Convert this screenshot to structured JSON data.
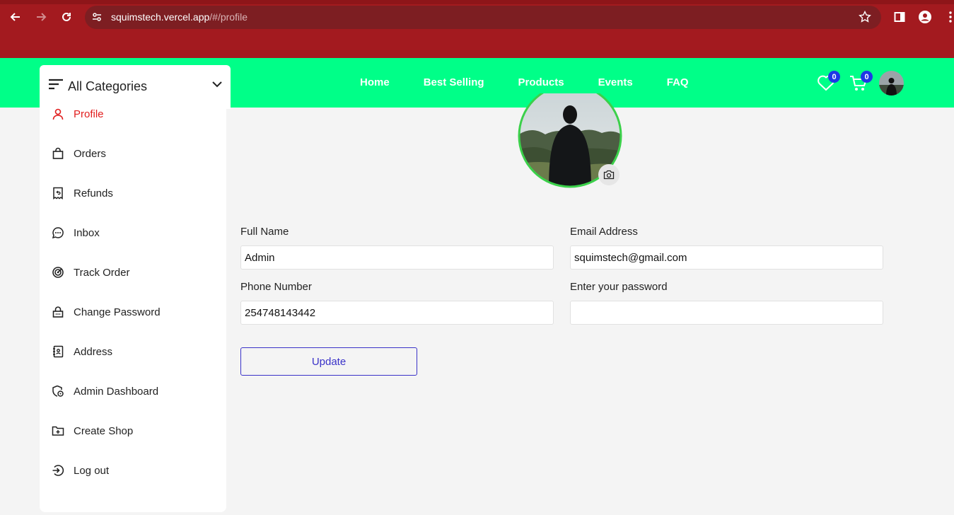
{
  "browser": {
    "url_host": "squimstech.vercel.app",
    "url_path": "/#/profile"
  },
  "header": {
    "categories_label": "All Categories",
    "nav": [
      "Home",
      "Best Selling",
      "Products",
      "Events",
      "FAQ"
    ],
    "wishlist_count": "0",
    "cart_count": "0"
  },
  "sidebar": {
    "items": [
      {
        "label": "Profile",
        "icon": "person-icon",
        "active": true
      },
      {
        "label": "Orders",
        "icon": "shopping-bag-icon"
      },
      {
        "label": "Refunds",
        "icon": "receipt-refund-icon"
      },
      {
        "label": "Inbox",
        "icon": "chat-bubble-icon"
      },
      {
        "label": "Track Order",
        "icon": "radar-icon"
      },
      {
        "label": "Change Password",
        "icon": "lock-icon"
      },
      {
        "label": "Address",
        "icon": "address-book-icon"
      },
      {
        "label": "Admin Dashboard",
        "icon": "admin-shield-icon"
      },
      {
        "label": "Create Shop",
        "icon": "folder-add-icon"
      },
      {
        "label": "Log out",
        "icon": "logout-icon"
      }
    ]
  },
  "form": {
    "full_name_label": "Full Name",
    "full_name_value": "Admin",
    "email_label": "Email Address",
    "email_value": "squimstech@gmail.com",
    "phone_label": "Phone Number",
    "phone_value": "254748143442",
    "password_label": "Enter your password",
    "password_value": "",
    "update_label": "Update"
  },
  "colors": {
    "browser_frame": "#a31a1f",
    "header_bg": "#00ff88",
    "active_item": "#e11d1d",
    "button_border": "#3a32c8",
    "avatar_ring": "#3bd04a",
    "badge": "#1f37e6"
  }
}
